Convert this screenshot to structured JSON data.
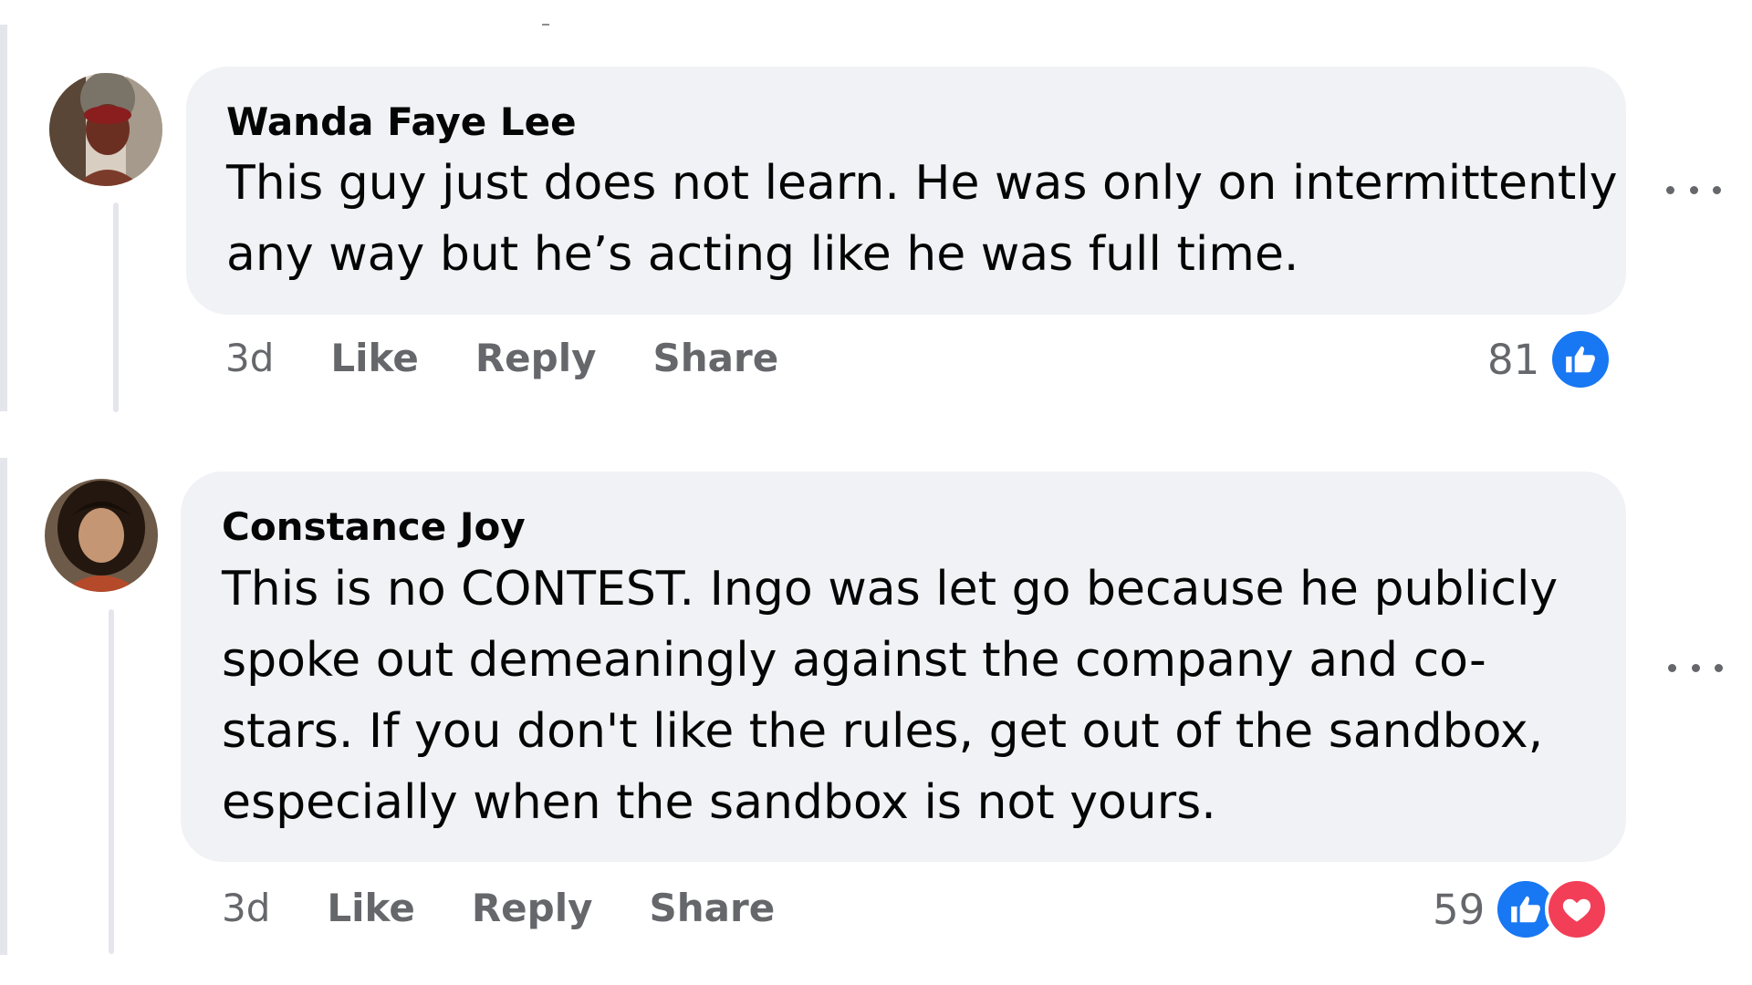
{
  "comments": [
    {
      "author": "Wanda Faye Lee",
      "lines": [
        "This guy just does not learn. He was only on intermittently",
        "any way but he’s acting like he was full time."
      ],
      "time": "3d",
      "like_label": "Like",
      "reply_label": "Reply",
      "share_label": "Share",
      "reaction_count": "81",
      "reactions": [
        "like-icon"
      ]
    },
    {
      "author": "Constance Joy",
      "lines": [
        "This is no CONTEST. Ingo was let go because he publicly",
        "spoke out demeaningly against the company and co-",
        "stars. If you don't like the rules, get out of the sandbox,",
        "especially when the sandbox is not yours."
      ],
      "time": "3d",
      "like_label": "Like",
      "reply_label": "Reply",
      "share_label": "Share",
      "reaction_count": "59",
      "reactions": [
        "like-icon",
        "love-icon"
      ]
    }
  ],
  "colors": {
    "bubble": "#f0f2f5",
    "meta_text": "#65676b",
    "like_blue": "#1877f2",
    "love_red": "#f33e58"
  }
}
